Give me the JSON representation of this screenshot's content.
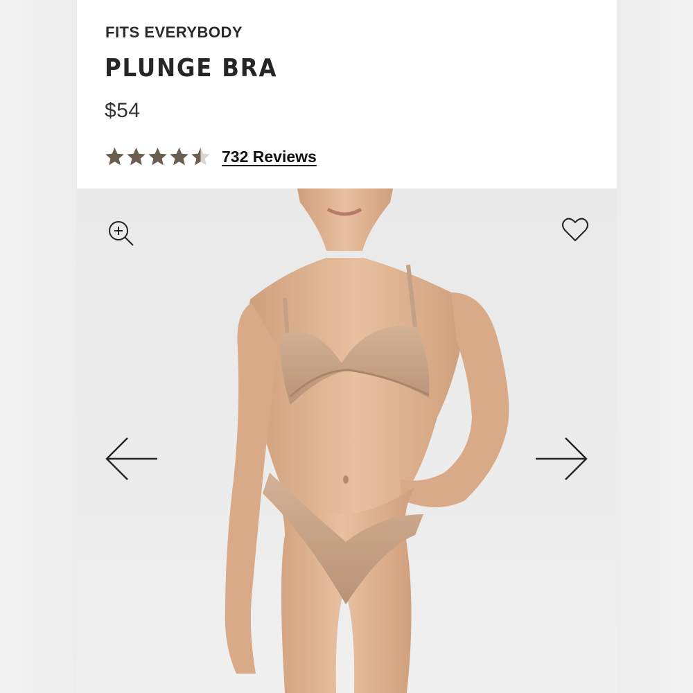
{
  "product": {
    "collection": "FITS EVERYBODY",
    "name": "PLUNGE BRA",
    "price": "$54",
    "rating_value": 4.5,
    "rating_max": 5,
    "reviews_label": "732 Reviews"
  },
  "gallery": {
    "image_alt": "Model wearing the plunge bra in a nude tone",
    "icons": {
      "zoom": "zoom-in-icon",
      "favorite": "heart-icon",
      "prev": "arrow-left-icon",
      "next": "arrow-right-icon"
    }
  },
  "colors": {
    "star": "#6b5d4f",
    "star_empty": "#d9d4cf",
    "text": "#262626",
    "background": "#ececec",
    "skin": "#e2b896",
    "garment": "#c9a688"
  }
}
